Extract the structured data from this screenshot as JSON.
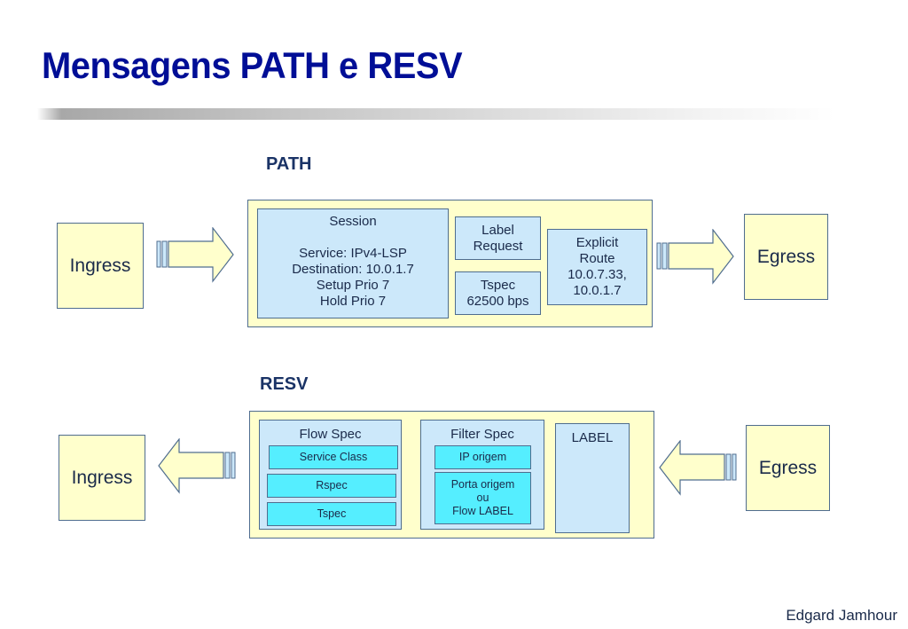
{
  "slide": {
    "title": "Mensagens PATH e RESV",
    "author": "Edgard Jamhour"
  },
  "path": {
    "label": "PATH",
    "ingress": "Ingress",
    "egress": "Egress",
    "session": {
      "title": "Session",
      "lines": [
        "Service: IPv4-LSP",
        "Destination: 10.0.1.7",
        "Setup Prio 7",
        "Hold Prio 7"
      ]
    },
    "label_request": [
      "Label",
      "Request"
    ],
    "tspec": [
      "Tspec",
      "62500 bps"
    ],
    "explicit_route": [
      "Explicit",
      "Route",
      "10.0.7.33,",
      "10.0.1.7"
    ]
  },
  "resv": {
    "label": "RESV",
    "ingress": "Ingress",
    "egress": "Egress",
    "flow_spec": {
      "title": "Flow Spec",
      "items": [
        "Service Class",
        "Rspec",
        "Tspec"
      ]
    },
    "filter_spec": {
      "title": "Filter Spec",
      "ip_origem": "IP origem",
      "porta": [
        "Porta origem",
        "ou",
        "Flow LABEL"
      ]
    },
    "label_obj": "LABEL"
  },
  "colors": {
    "title": "#000e96",
    "node_fill": "#ffffcc",
    "object_fill": "#cce8fa",
    "sub_object_fill": "#55eeff",
    "border": "#4f6d8f"
  }
}
